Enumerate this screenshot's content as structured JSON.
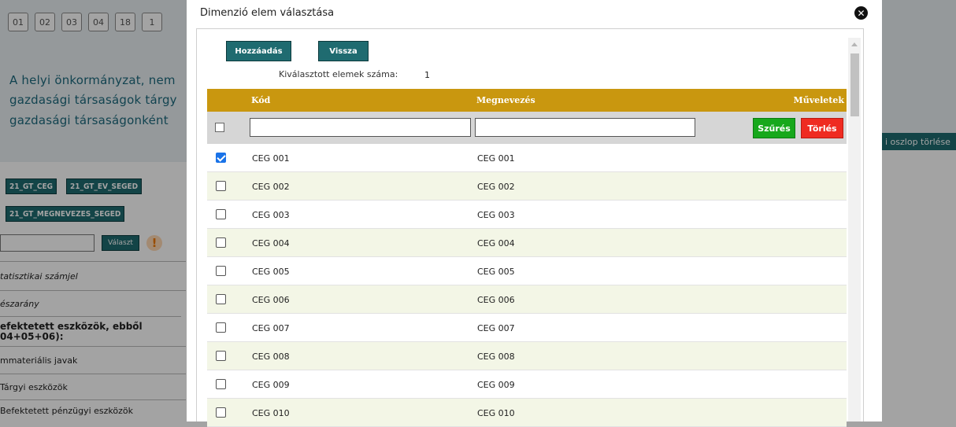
{
  "background": {
    "chips": [
      "01",
      "02",
      "03",
      "04",
      "18",
      "1"
    ],
    "text_lines": [
      "A helyi önkormányzat, nem",
      "gazdasági társaságok tárgy",
      "gazdasági társaságonként"
    ],
    "tags": [
      "21_GT_CEG",
      "21_GT_EV_SEGED",
      "21_GT_MEGNEVEZES_SEGED"
    ],
    "valaszt_label": "Választ",
    "warn_symbol": "!",
    "column_delete_label": "i oszlop törlése",
    "rows": [
      "tatisztikai számjel",
      "észarány",
      "efektetett eszközök, ebből 04+05+06):",
      "mmateriális javak",
      "Tárgyi eszközök",
      "Befektetett pénzügyi eszközök"
    ]
  },
  "modal": {
    "title": "Dimenzió elem választása",
    "close_symbol": "✕",
    "add_button": "Hozzáadás",
    "back_button": "Vissza",
    "count_label": "Kiválasztott elemek száma:",
    "count_value": "1",
    "table": {
      "headers": {
        "kod": "Kód",
        "megnevezes": "Megnevezés",
        "muveletek": "Műveletek"
      },
      "filter_button": "Szűrés",
      "clear_button": "Törlés",
      "filter_kod_value": "",
      "filter_megn_value": "",
      "rows": [
        {
          "kod": "CEG 001",
          "megnevezes": "CEG 001",
          "checked": true
        },
        {
          "kod": "CEG 002",
          "megnevezes": "CEG 002",
          "checked": false
        },
        {
          "kod": "CEG 003",
          "megnevezes": "CEG 003",
          "checked": false
        },
        {
          "kod": "CEG 004",
          "megnevezes": "CEG 004",
          "checked": false
        },
        {
          "kod": "CEG 005",
          "megnevezes": "CEG 005",
          "checked": false
        },
        {
          "kod": "CEG 006",
          "megnevezes": "CEG 006",
          "checked": false
        },
        {
          "kod": "CEG 007",
          "megnevezes": "CEG 007",
          "checked": false
        },
        {
          "kod": "CEG 008",
          "megnevezes": "CEG 008",
          "checked": false
        },
        {
          "kod": "CEG 009",
          "megnevezes": "CEG 009",
          "checked": false
        },
        {
          "kod": "CEG 010",
          "megnevezes": "CEG 010",
          "checked": false
        }
      ]
    }
  },
  "colors": {
    "header_gold": "#c9970f",
    "teal_button": "#1f6b70",
    "filter_green": "#17a81c",
    "clear_red": "#ef2b21",
    "row_alt": "#f3f6e6",
    "checkbox_blue": "#1a73e8"
  }
}
